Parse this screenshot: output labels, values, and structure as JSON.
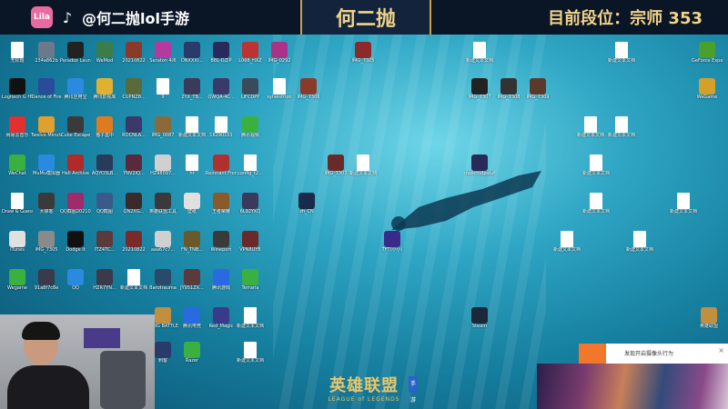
{
  "stream": {
    "handle": "@何二抛lol手游",
    "streamer_name": "何二抛",
    "rank_text": "目前段位：宗师 353",
    "logo_text": "Lila"
  },
  "desktop_icons": [
    {
      "label": "无标题",
      "color": "#ffffff"
    },
    {
      "label": "234a862b",
      "color": "#6a7a8a"
    },
    {
      "label": "Paradox Launcher v2",
      "color": "#222"
    },
    {
      "label": "WeMod",
      "color": "#3a7d4a"
    },
    {
      "label": "20210822",
      "color": "#8a3a2a"
    },
    {
      "label": "Seraton 4/6",
      "color": "#b43aa0"
    },
    {
      "label": "DNXXXI...",
      "color": "#2a3a6a"
    },
    {
      "label": "BBL-DZIP",
      "color": "#2a2a5a"
    },
    {
      "label": "L068_HXZ",
      "color": "#b33"
    },
    {
      "label": "IMG_0292",
      "color": "#a38"
    },
    {
      "label": "IMG_7305",
      "color": "#8a2a2a"
    },
    {
      "label": "新建文本文档",
      "color": "#ffffff"
    },
    {
      "label": "新建文本文档",
      "color": "#ffffff"
    },
    {
      "label": "GeForce Experience",
      "color": "#4aa02a"
    },
    {
      "label": "Logitech G HUB",
      "color": "#111"
    },
    {
      "label": "Dance of Fire",
      "color": "#2a4a9a"
    },
    {
      "label": "腾讯应用宝",
      "color": "#2a8ae0"
    },
    {
      "label": "腾讯影视库",
      "color": "#e0b030"
    },
    {
      "label": "CUPNZ8...",
      "color": "#5a6a3a"
    },
    {
      "label": "9",
      "color": "#ffffff"
    },
    {
      "label": "2YX_TB...",
      "color": "#3a3a5a"
    },
    {
      "label": "QWQA-4C...",
      "color": "#3a3a6a"
    },
    {
      "label": "LIFCDPY",
      "color": "#3a4a5a"
    },
    {
      "label": "sylvestrion",
      "color": "#ffffff"
    },
    {
      "label": "IMG_7306",
      "color": "#8a3a2a"
    },
    {
      "label": "IMG_7307",
      "color": "#222"
    },
    {
      "label": "IMG_7308",
      "color": "#333"
    },
    {
      "label": "IMG_7309",
      "color": "#5a3a2a"
    },
    {
      "label": "WeGame",
      "color": "#d4a02a"
    },
    {
      "label": "网易云音乐",
      "color": "#e03030"
    },
    {
      "label": "Twelve Minutes",
      "color": "#e0a030"
    },
    {
      "label": "Cube Escape",
      "color": "#3a3a3a"
    },
    {
      "label": "猫子盒中",
      "color": "#e07a20"
    },
    {
      "label": "ROCNLA...",
      "color": "#3a3a6a"
    },
    {
      "label": "IMG_0087",
      "color": "#8a6a3a"
    },
    {
      "label": "新建文本文档",
      "color": "#ffffff"
    },
    {
      "label": "16290101",
      "color": "#ffffff"
    },
    {
      "label": "腾讯视频",
      "color": "#3ab040"
    },
    {
      "label": "新建文本文档",
      "color": "#ffffff"
    },
    {
      "label": "新建文本文档",
      "color": "#ffffff"
    },
    {
      "label": "WeChat",
      "color": "#3ab040"
    },
    {
      "label": "MuMu模拟器",
      "color": "#2a8ae0"
    },
    {
      "label": "Hell Archive",
      "color": "#b02a2a"
    },
    {
      "label": "AQYO3LB...",
      "color": "#2a3a5a"
    },
    {
      "label": "YNV2IQ...",
      "color": "#5a2a3a"
    },
    {
      "label": "HZ98097...",
      "color": "#d0d0d0"
    },
    {
      "label": "ht",
      "color": "#ffffff"
    },
    {
      "label": "Remnant From...",
      "color": "#b03030"
    },
    {
      "label": "config_t2...",
      "color": "#ffffff"
    },
    {
      "label": "IMG_7307",
      "color": "#6a2a2a"
    },
    {
      "label": "新建文本文档",
      "color": "#ffffff"
    },
    {
      "label": "mascmdpstuf",
      "color": "#2a2a5a"
    },
    {
      "label": "新建文本文档",
      "color": "#ffffff"
    },
    {
      "label": "Draw & Guess",
      "color": "#ffffff"
    },
    {
      "label": "大镖客",
      "color": "#3a3a3a"
    },
    {
      "label": "QQ截图20210826",
      "color": "#a02a6a"
    },
    {
      "label": "QQ截图",
      "color": "#3a5a8a"
    },
    {
      "label": "QN2XG...",
      "color": "#3a2a2a"
    },
    {
      "label": "英雄联盟工具",
      "color": "#3a3a3a"
    },
    {
      "label": "壁纸",
      "color": "#e0e0e0"
    },
    {
      "label": "王者荣耀",
      "color": "#8a5a2a"
    },
    {
      "label": "6L92YKQ",
      "color": "#3a3a5a"
    },
    {
      "label": "zh_CN",
      "color": "#1a2a4a"
    },
    {
      "label": "新建文本文档",
      "color": "#ffffff"
    },
    {
      "label": "新建文本文档",
      "color": "#ffffff"
    },
    {
      "label": "iTunes",
      "color": "#e0e0e0"
    },
    {
      "label": "IMG_7305",
      "color": "#8a8a8a"
    },
    {
      "label": "Dodge It",
      "color": "#111"
    },
    {
      "label": "ITZ4TC...",
      "color": "#5a3a3a"
    },
    {
      "label": "20210822",
      "color": "#7a2a2a"
    },
    {
      "label": "aaa67c7...",
      "color": "#d0d0d0"
    },
    {
      "label": "FN_TNB...",
      "color": "#6a5a2a"
    },
    {
      "label": "Wineport",
      "color": "#3a3a3a"
    },
    {
      "label": "VPN8UYB",
      "color": "#6a2a2a"
    },
    {
      "label": "TFT(小小)",
      "color": "#3a2a8a"
    },
    {
      "label": "新建文本文档",
      "color": "#ffffff"
    },
    {
      "label": "新建文本文档",
      "color": "#ffffff"
    },
    {
      "label": "Wegame",
      "color": "#3ab040"
    },
    {
      "label": "91a8f7c8e",
      "color": "#3a3a4a"
    },
    {
      "label": "QQ",
      "color": "#2a8ae0"
    },
    {
      "label": "HZR7YN...",
      "color": "#3a3a4a"
    },
    {
      "label": "新建文本文档",
      "color": "#ffffff"
    },
    {
      "label": "Barotrauma",
      "color": "#2a4a6a"
    },
    {
      "label": "JY951ZX...",
      "color": "#5a3a3a"
    },
    {
      "label": "腾讯游戏",
      "color": "#2a6ae0"
    },
    {
      "label": "Terraria",
      "color": "#3ab040"
    },
    {
      "label": "PUBG BATTLEGR...",
      "color": "#c09040"
    },
    {
      "label": "腾讯电竞",
      "color": "#2a6ae0"
    },
    {
      "label": "Red_Magic",
      "color": "#3a3a8a"
    },
    {
      "label": "新建文本文档",
      "color": "#ffffff"
    },
    {
      "label": "Steam",
      "color": "#1b2838"
    },
    {
      "label": "英雄联盟",
      "color": "#c09040"
    },
    {
      "label": "刺客",
      "color": "#2a3a6a"
    },
    {
      "label": "Razer",
      "color": "#3ab040"
    },
    {
      "label": "新建文本文档",
      "color": "#ffffff"
    }
  ],
  "lol_logo": {
    "cn": "英雄联盟",
    "en": "LEAGUE of LEGENDS",
    "badge": "手游"
  },
  "notification": {
    "text": "发现开启摄像头行为",
    "close": "×"
  }
}
